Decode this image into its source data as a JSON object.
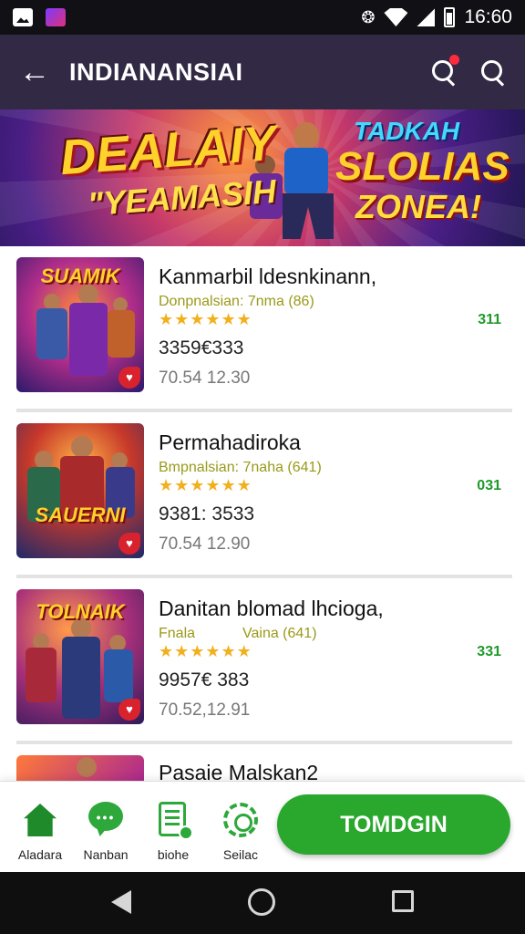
{
  "status_bar": {
    "time": "16:60"
  },
  "app_bar": {
    "title": "INDIANANSIAI",
    "back_icon": "arrow-left-icon",
    "notification_search_icon": "search-icon",
    "search_icon": "search-icon"
  },
  "banner": {
    "heading": "DEALAIY",
    "subheading": "\"YEAMASIH",
    "tag": "TADKAH",
    "title_line1": "SLOLIAS",
    "title_line2": "ZONEA!"
  },
  "items": [
    {
      "thumb_title": "SUAMIK",
      "name": "Kanmarbil ldesnkinann,",
      "meta": "Donpnalsian: 7nma (86)",
      "meta2": "",
      "stars": "★★★★★★",
      "price": "3359€333",
      "code": "70.54 12.30",
      "count": "311"
    },
    {
      "thumb_title": "SAUERNI",
      "name": "Permahadiroka",
      "meta": "Bmpnalsian: 7naha (641)",
      "meta2": "",
      "stars": "★★★★★★",
      "price": "9381: 3533",
      "code": "70.54 12.90",
      "count": "031"
    },
    {
      "thumb_title": "TOLNAIK",
      "name": "Danitan blomad lhcioga,",
      "meta": "Fnala",
      "meta2": "Vaina (641)",
      "stars": "★★★★★★",
      "price": "9957€ 383",
      "code": "70.52,12.91",
      "count": "331"
    },
    {
      "thumb_title": "",
      "name": "Pasaie Malskan2",
      "meta": "",
      "meta2": "",
      "stars": "",
      "price": "",
      "code": "",
      "count": ""
    }
  ],
  "bottom_nav": {
    "items": [
      {
        "label": "Aladara",
        "icon": "home-icon"
      },
      {
        "label": "Nanban",
        "icon": "chat-icon"
      },
      {
        "label": "biohe",
        "icon": "document-icon"
      },
      {
        "label": "Seilac",
        "icon": "settings-icon"
      }
    ],
    "primary_button": "TOMDGIN"
  },
  "colors": {
    "app_bar": "#322a45",
    "accent_green": "#2aa82e",
    "star": "#f2b01e"
  }
}
